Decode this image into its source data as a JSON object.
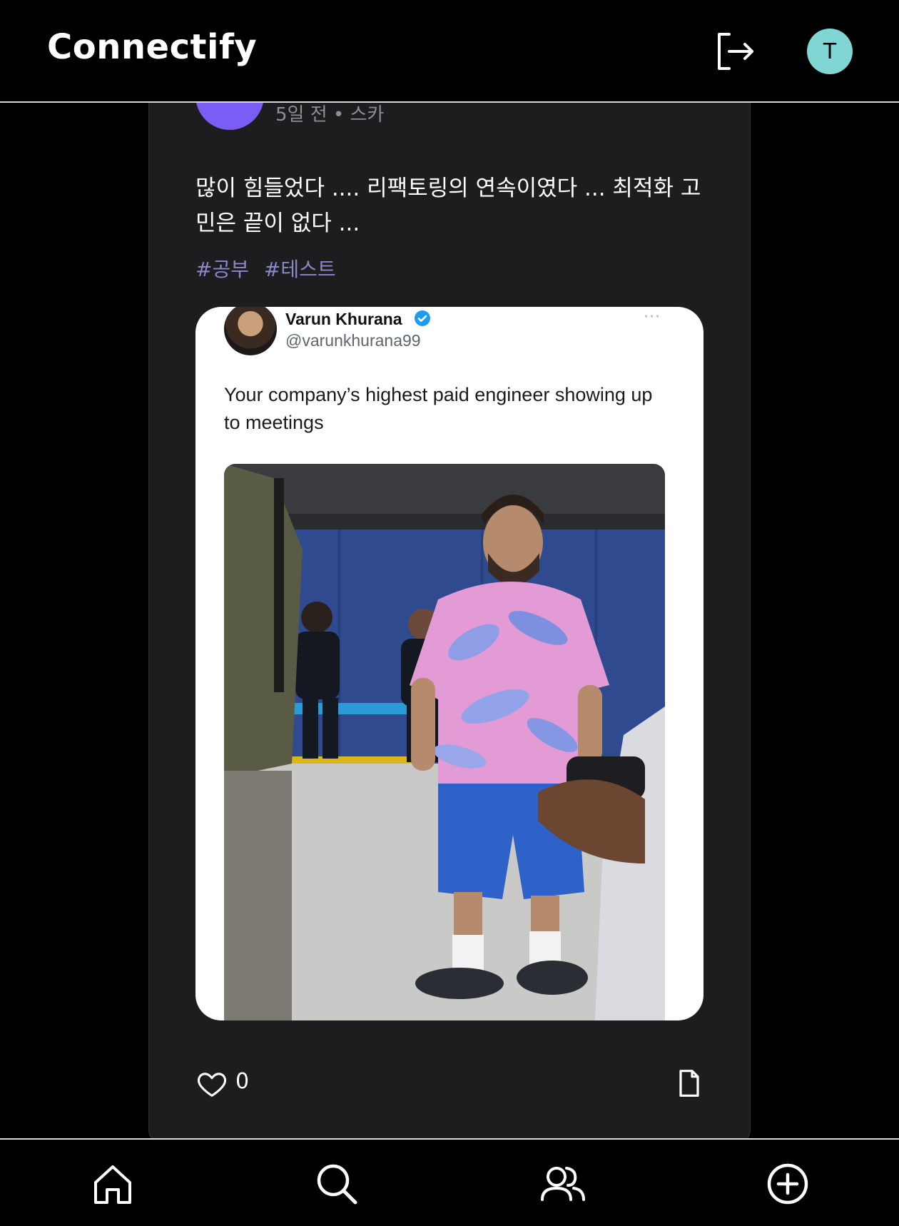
{
  "header": {
    "app_name": "Connectify",
    "logout_icon": "logout-icon",
    "user_initial": "T"
  },
  "post": {
    "meta": "5일 전 • 스카",
    "text": "많이 힘들었다 .... 리팩토링의 연속이였다 ... 최적화 고민은 끝이 없다 ...",
    "hashtags": [
      "#공부",
      "#테스트"
    ],
    "embed": {
      "name": "Varun Khurana",
      "handle": "@varunkhurana99",
      "text": "Your company’s highest paid engineer showing up to meetings",
      "more": "···"
    },
    "likes": "0"
  },
  "colors": {
    "accent_avatar": "#7b5cf5",
    "user_avatar": "#7fd6d2",
    "hashtag": "#8b88c9"
  },
  "bottom_nav": {
    "items": [
      "home-icon",
      "search-icon",
      "friends-icon",
      "add-circle-icon"
    ]
  }
}
